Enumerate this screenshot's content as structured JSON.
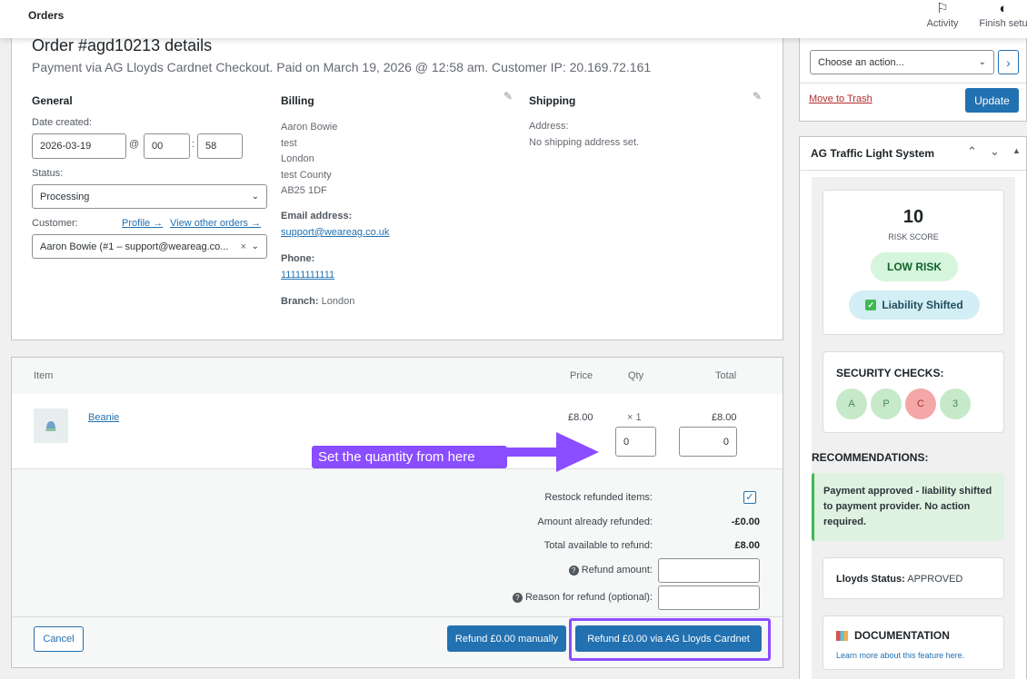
{
  "topbar": {
    "title": "Orders",
    "activity_label": "Activity",
    "finish_label": "Finish setu",
    "activity_icon": "flag-icon",
    "finish_icon": "half-circle-icon"
  },
  "order": {
    "heading": "Order #agd10213 details",
    "subheading": "Payment via AG Lloyds Cardnet Checkout. Paid on March 19, 2026 @ 12:58 am. Customer IP: 20.169.72.161"
  },
  "general": {
    "title": "General",
    "date_label": "Date created:",
    "date_value": "2026-03-19",
    "at_sign": "@",
    "hour": "00",
    "colon": ":",
    "minute": "58",
    "status_label": "Status:",
    "status_value": "Processing",
    "customer_label": "Customer:",
    "profile_link": "Profile →",
    "other_orders_link": "View other orders →",
    "customer_value": "Aaron Bowie (#1 – support@weareag.co...",
    "clear_x": "×"
  },
  "billing": {
    "title": "Billing",
    "address_lines": [
      "Aaron Bowie",
      "test",
      "London",
      "test County",
      "AB25 1DF"
    ],
    "email_label": "Email address:",
    "email": "support@weareag.co.uk",
    "phone_label": "Phone:",
    "phone": "11111111111",
    "branch_label": "Branch:",
    "branch_value": "London"
  },
  "shipping": {
    "title": "Shipping",
    "address_label": "Address:",
    "address_value": "No shipping address set."
  },
  "items": {
    "headers": {
      "item": "Item",
      "price": "Price",
      "qty": "Qty",
      "total": "Total"
    },
    "rows": [
      {
        "name": "Beanie",
        "price": "£8.00",
        "qty": "× 1",
        "total": "£8.00",
        "refund_qty": "0",
        "refund_total": "0"
      }
    ]
  },
  "callout": {
    "text": "Set the quantity from here"
  },
  "refund": {
    "restock_label": "Restock refunded items:",
    "already_label": "Amount already refunded:",
    "already_value": "-£0.00",
    "available_label": "Total available to refund:",
    "available_value": "£8.00",
    "amount_label": "Refund amount:",
    "reason_label": "Reason for refund (optional):",
    "cancel_label": "Cancel",
    "manual_label": "Refund £0.00 manually",
    "gateway_label": "Refund £0.00 via AG Lloyds Cardnet"
  },
  "actions": {
    "choose_placeholder": "Choose an action...",
    "go_arrow": "›",
    "trash_label": "Move to Trash",
    "update_label": "Update"
  },
  "traffic": {
    "title": "AG Traffic Light System",
    "score": "10",
    "score_label": "RISK SCORE",
    "risk_badge": "LOW RISK",
    "liability_badge": "Liability Shifted",
    "checks_title": "SECURITY CHECKS:",
    "checks": [
      "A",
      "P",
      "C",
      "3"
    ],
    "rec_title": "RECOMMENDATIONS:",
    "rec_text": "Payment approved - liability shifted to payment provider. No action required.",
    "status_label": "Lloyds Status:",
    "status_value": "APPROVED",
    "doc_title": "DOCUMENTATION",
    "doc_link": "Learn more about this feature here."
  },
  "colors": {
    "accent": "#2271b1",
    "callout_purple": "#7b4dff",
    "green_check": "#c6e9c9",
    "red_check": "#f4a7a7",
    "low_risk_bg": "#d5f5dc",
    "liability_bg": "#d3eef4"
  }
}
